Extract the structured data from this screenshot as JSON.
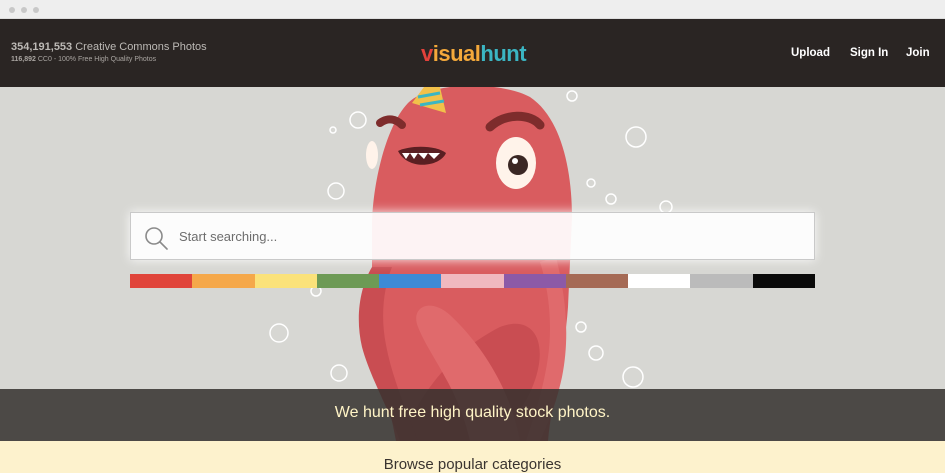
{
  "header": {
    "stats_count": "354,191,553",
    "stats_label": " Creative Commons Photos",
    "cc0_count": "116,892",
    "cc0_label": " CC0 - 100% Free High Quality Photos",
    "logo_part1": "v",
    "logo_part2": "isual",
    "logo_part3": "hunt",
    "nav": {
      "upload": "Upload",
      "signin": "Sign In",
      "join": "Join"
    }
  },
  "search": {
    "placeholder": "Start searching..."
  },
  "colors": [
    "#e0443a",
    "#f5a84a",
    "#fbe27a",
    "#6d9a55",
    "#3d8ad6",
    "#f0b8bf",
    "#8c5aa7",
    "#a56a55",
    "#ffffff",
    "#bbbbbb",
    "#0a0a0a"
  ],
  "banner": {
    "text": "We hunt free high quality stock photos."
  },
  "categories": {
    "title": "Browse popular categories"
  },
  "icons": {
    "search": "search-icon",
    "logo": "visualhunt-logo"
  }
}
